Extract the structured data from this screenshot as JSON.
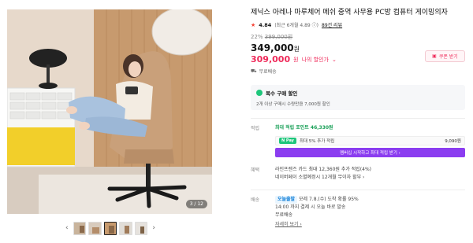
{
  "gallery": {
    "counter": "3 / 12",
    "prev_arrow": "‹",
    "next_arrow": "›",
    "thumb_count": 5
  },
  "product": {
    "title": "제닉스 아레나 마루체어 메쉬 중역 사무용 PC방 컴퓨터 게이밍의자",
    "rating": {
      "star": "★",
      "score": "4.84",
      "meta": "(최근 6개월 4.89 ⓘ)",
      "reviews": "89건 리뷰"
    },
    "discount_rate": "22%",
    "original_price": "399,000원",
    "price": "349,000",
    "price_unit": "원",
    "my_price": "309,000",
    "my_price_unit": "원",
    "my_price_label": "나의 할인가",
    "coupon_label": "쿠폰 받기",
    "free_shipping": "무료배송"
  },
  "multi_purchase": {
    "title": "복수 구매 할인",
    "desc": "2개 이상 구매시 수량만큼 7,000원 할인"
  },
  "points": {
    "label": "적립",
    "max_point": "최대 적립 포인트 46,330원",
    "npay_tag": "N Pay",
    "extra_text": "최대 5% 추가 적립",
    "extra_value": "9,090원",
    "cta": "멤버십 시작하고 최대 적립 받기 ›"
  },
  "benefit": {
    "label": "혜택",
    "line1": "라인프렌즈 카드 최대 12,360원 추가 적립(4%)",
    "line2": "네이버페이 소멸예정시 12개월 무이자 할부 ›"
  },
  "delivery": {
    "label": "배송",
    "today_tag": "오늘출발",
    "line1": "모레 7.8.(수) 도착 확률 95%",
    "line2": "14:00 까지 결제 시 오늘 바로 발송",
    "line3": "무료배송",
    "detail_link": "자세히 보기 ›"
  },
  "colors": {
    "accent_red": "#ef2a5a",
    "npay_green": "#1ec67b",
    "cta_purple": "#8b3df0"
  }
}
